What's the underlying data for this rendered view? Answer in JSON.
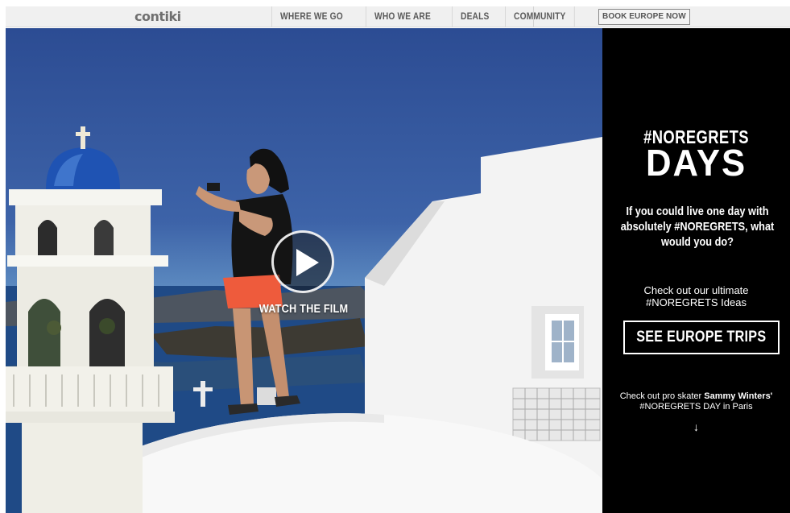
{
  "header": {
    "logo": "contiki",
    "nav": [
      "WHERE WE GO",
      "WHO WE ARE",
      "DEALS",
      "COMMUNITY"
    ],
    "book_label": "BOOK EUROPE NOW"
  },
  "hero": {
    "watch_label": "WATCH THE FILM"
  },
  "panel": {
    "title_line1": "#NOREGRETS",
    "title_line2": "DAYS",
    "question": "If you could live one day with absolutely #NOREGRETS, what would you do?",
    "sub_line1": "Check out our ultimate",
    "sub_line2": "#NOREGRETS Ideas",
    "cta_label": "SEE EUROPE TRIPS",
    "foot_prefix": "Check out pro skater",
    "foot_name": "Sammy Winters'",
    "foot_suffix": "#NOREGRETS DAY in Paris",
    "arrow": "↓"
  }
}
